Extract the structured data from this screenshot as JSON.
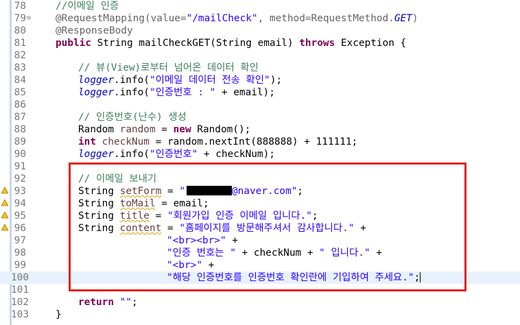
{
  "editor": {
    "lines": [
      {
        "num": "78"
      },
      {
        "num": "79"
      },
      {
        "num": "80"
      },
      {
        "num": "81"
      },
      {
        "num": "82"
      },
      {
        "num": "83"
      },
      {
        "num": "84"
      },
      {
        "num": "85"
      },
      {
        "num": "86"
      },
      {
        "num": "87"
      },
      {
        "num": "88"
      },
      {
        "num": "89"
      },
      {
        "num": "90"
      },
      {
        "num": "91"
      },
      {
        "num": "92"
      },
      {
        "num": "93"
      },
      {
        "num": "94"
      },
      {
        "num": "95"
      },
      {
        "num": "96"
      },
      {
        "num": "97"
      },
      {
        "num": "98"
      },
      {
        "num": "99"
      },
      {
        "num": "100"
      },
      {
        "num": "101"
      },
      {
        "num": "102"
      },
      {
        "num": "103"
      }
    ],
    "code": {
      "c78": "//이메일 인증",
      "c79a": "@RequestMapping(value=",
      "c79b": "\"/mailCheck\"",
      "c79c": ", method=RequestMethod.",
      "c79d": "GET",
      "c79e": ")",
      "c80": "@ResponseBody",
      "c81a": "public",
      "c81b": " String mailCheckGET(String email) ",
      "c81c": "throws",
      "c81d": " Exception {",
      "c83": "// 뷰(View)로부터 넘어온 데이터 확인",
      "c84a": "logger",
      "c84b": ".info(",
      "c84c": "\"이메일 데이터 전송 확인\"",
      "c84d": ");",
      "c85a": "logger",
      "c85b": ".info(",
      "c85c": "\"인증번호 : \"",
      "c85d": " + email);",
      "c87": "// 인증번호(난수) 생성",
      "c88a": "Random ",
      "c88b": "random",
      "c88c": " = ",
      "c88d": "new",
      "c88e": " Random();",
      "c89a": "int",
      "c89b": " checkNum",
      "c89c": " = random.nextInt(888888) + 111111;",
      "c90a": "logger",
      "c90b": ".info(",
      "c90c": "\"인증번호\"",
      "c90d": " + checkNum);",
      "c92": "// 이메일 보내기",
      "c93a": "String ",
      "c93b": "setForm",
      "c93c": " = ",
      "c93d": "\"",
      "c93e": "@naver.com\"",
      "c93f": ";",
      "c94a": "String ",
      "c94b": "toMail",
      "c94c": " = email;",
      "c95a": "String ",
      "c95b": "title",
      "c95c": " = ",
      "c95d": "\"회원가입 인증 이메일 입니다.\"",
      "c95e": ";",
      "c96a": "String ",
      "c96b": "content",
      "c96c": " = ",
      "c96d": "\"홈페이지를 방문해주셔서 감사합니다.\"",
      "c96e": " +",
      "c97a": "\"<br><br>\"",
      "c97b": " +",
      "c98a": "\"인증 번호는 \"",
      "c98b": " + checkNum + ",
      "c98c": "\" 입니다.\"",
      "c98d": " +",
      "c99a": "\"<br>\"",
      "c99b": " +",
      "c100a": "\"해당 인증번호를 인증번호 확인란에 기입하여 주세요.\"",
      "c100b": ";",
      "c102a": "return",
      "c102b": " ",
      "c102c": "\"\"",
      "c102d": ";",
      "c103": "}"
    }
  },
  "colors": {
    "keyword": "#7f0055",
    "comment": "#3f7f5f",
    "string": "#2a00ff",
    "field": "#0000c0",
    "local_variable": "#6a3e3e",
    "annotation": "#646464",
    "current_line": "#e8f2fe",
    "highlight_box": "#e0201b"
  },
  "icons": {
    "fold": "collapse-minus-icon",
    "warning": "warning-marker-icon"
  }
}
